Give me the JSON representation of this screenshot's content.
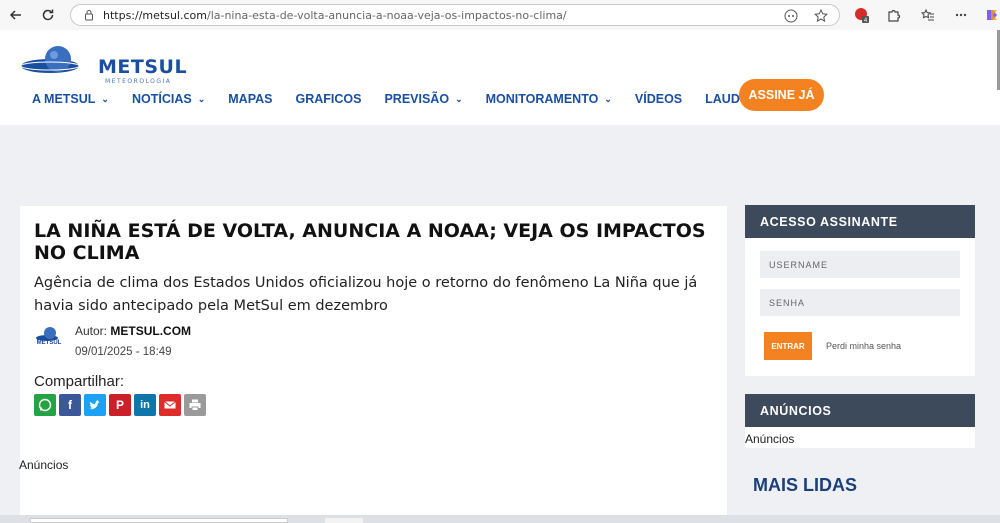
{
  "browser": {
    "url_host": "https://metsul.com",
    "url_path": "/la-nina-esta-de-volta-anuncia-a-noaa-veja-os-impactos-no-clima/",
    "extension_badge": "4"
  },
  "site": {
    "logo_text": "METSUL",
    "logo_sub": "METEOROLOGIA",
    "menu": [
      {
        "label": "A METSUL",
        "dropdown": true
      },
      {
        "label": "NOTÍCIAS",
        "dropdown": true
      },
      {
        "label": "MAPAS",
        "dropdown": false
      },
      {
        "label": "GRAFICOS",
        "dropdown": false
      },
      {
        "label": "PREVISÃO",
        "dropdown": true
      },
      {
        "label": "MONITORAMENTO",
        "dropdown": true
      },
      {
        "label": "VÍDEOS",
        "dropdown": false
      },
      {
        "label": "LAUDOS",
        "dropdown": false
      }
    ],
    "cta_label": "ASSINE JÁ",
    "brand_color": "#1a4fa0",
    "accent_color": "#f58220"
  },
  "article": {
    "title": "LA NIÑA ESTÁ DE VOLTA, ANUNCIA A NOAA; VEJA OS IMPACTOS NO CLIMA",
    "lede": "Agência de clima dos Estados Unidos oficializou hoje o retorno do fenômeno La Niña que já havia sido antecipado pela MetSul em dezembro",
    "author_prefix": "Autor:",
    "author_name": "METSUL.COM",
    "date": "09/01/2025 - 18:49",
    "share_label": "Compartilhar:",
    "share_buttons": [
      {
        "name": "whatsapp-icon",
        "color": "#25a244"
      },
      {
        "name": "facebook-icon",
        "color": "#3b5998",
        "glyph": "f"
      },
      {
        "name": "twitter-icon",
        "color": "#1da1f2"
      },
      {
        "name": "pinterest-icon",
        "color": "#cb2027",
        "glyph": "P"
      },
      {
        "name": "linkedin-icon",
        "color": "#0e76a8",
        "glyph": "in"
      },
      {
        "name": "email-icon",
        "color": "#e02b2b"
      },
      {
        "name": "print-icon",
        "color": "#9a9a9a"
      }
    ],
    "ads_label": "Anúncios"
  },
  "sidebar": {
    "login": {
      "title": "ACESSO ASSINANTE",
      "username_placeholder": "USERNAME",
      "password_placeholder": "SENHA",
      "submit_label": "ENTRAR",
      "forgot_label": "Perdi minha senha"
    },
    "ads": {
      "title": "ANÚNCIOS",
      "text": "Anúncios"
    },
    "mais_lidas": "MAIS LIDAS"
  }
}
